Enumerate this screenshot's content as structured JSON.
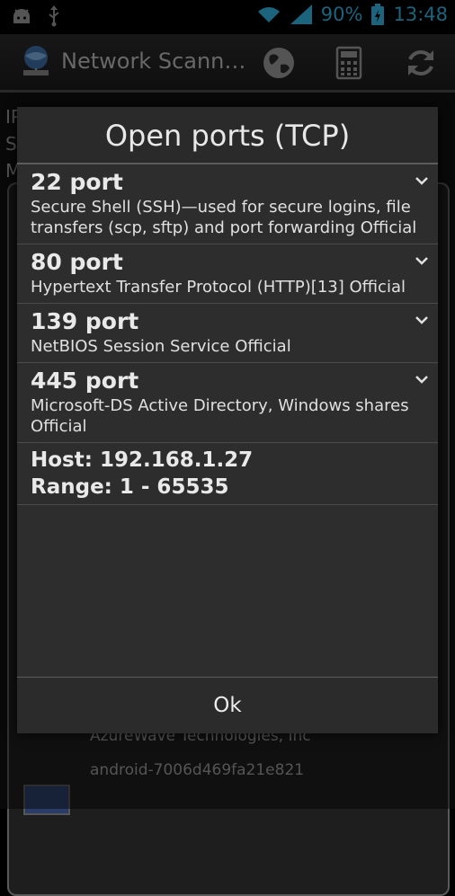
{
  "status_bar": {
    "battery": "90%",
    "time": "13:48",
    "icons": [
      "android-icon",
      "usb-icon",
      "wifi-icon",
      "signal-icon",
      "battery-icon"
    ]
  },
  "action_bar": {
    "title": "Network Scann…",
    "icons": [
      "network-app-icon",
      "globe-icon",
      "calculator-icon",
      "refresh-icon"
    ]
  },
  "background": {
    "lines": [
      "IP",
      "S",
      "M"
    ],
    "rows": [
      "AzureWave Technologies, Inc",
      "android-7006d469fa21e821"
    ]
  },
  "dialog": {
    "title": "Open ports (TCP)",
    "ports": [
      {
        "title": "22 port",
        "desc": "Secure Shell (SSH)—used for secure logins, file transfers (scp, sftp) and port forwarding  Official"
      },
      {
        "title": "80 port",
        "desc": "Hypertext Transfer Protocol (HTTP)[13] Official"
      },
      {
        "title": "139 port",
        "desc": "NetBIOS Session Service Official"
      },
      {
        "title": "445 port",
        "desc": "Microsoft-DS Active Directory, Windows shares Official"
      }
    ],
    "host": "Host: 192.168.1.27",
    "range": "Range: 1 - 65535",
    "ok_label": "Ok"
  }
}
